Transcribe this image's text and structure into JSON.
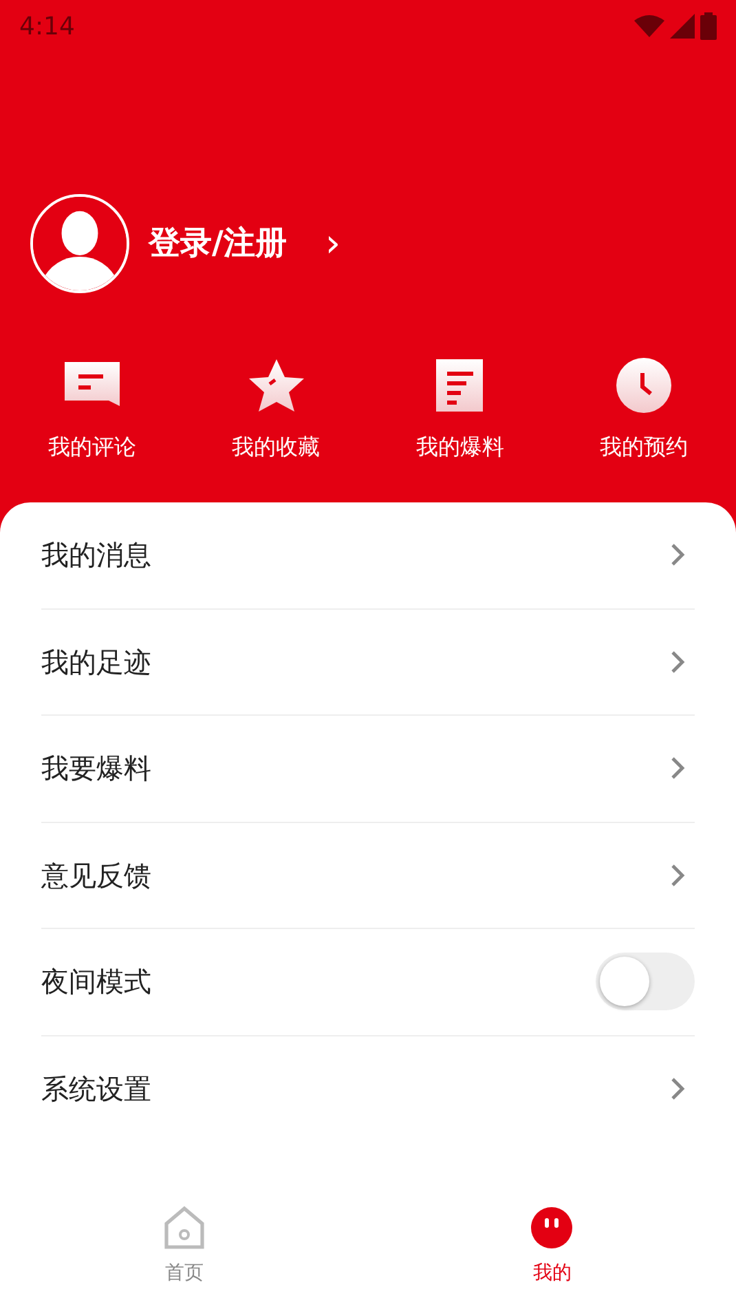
{
  "status_bar": {
    "time": "4:14"
  },
  "profile": {
    "login_label": "登录/注册",
    "arrow": "›"
  },
  "shortcuts": [
    {
      "kind": "comment",
      "label": "我的评论"
    },
    {
      "kind": "star",
      "label": "我的收藏"
    },
    {
      "kind": "document",
      "label": "我的爆料"
    },
    {
      "kind": "clock",
      "label": "我的预约"
    }
  ],
  "menu": [
    {
      "kind": "link",
      "label": "我的消息"
    },
    {
      "kind": "link",
      "label": "我的足迹"
    },
    {
      "kind": "link",
      "label": "我要爆料"
    },
    {
      "kind": "link",
      "label": "意见反馈"
    },
    {
      "kind": "toggle",
      "label": "夜间模式",
      "on": false
    },
    {
      "kind": "link",
      "label": "系统设置"
    }
  ],
  "tabs": [
    {
      "kind": "home",
      "label": "首页",
      "selected": false
    },
    {
      "kind": "me",
      "label": "我的",
      "selected": true
    }
  ]
}
